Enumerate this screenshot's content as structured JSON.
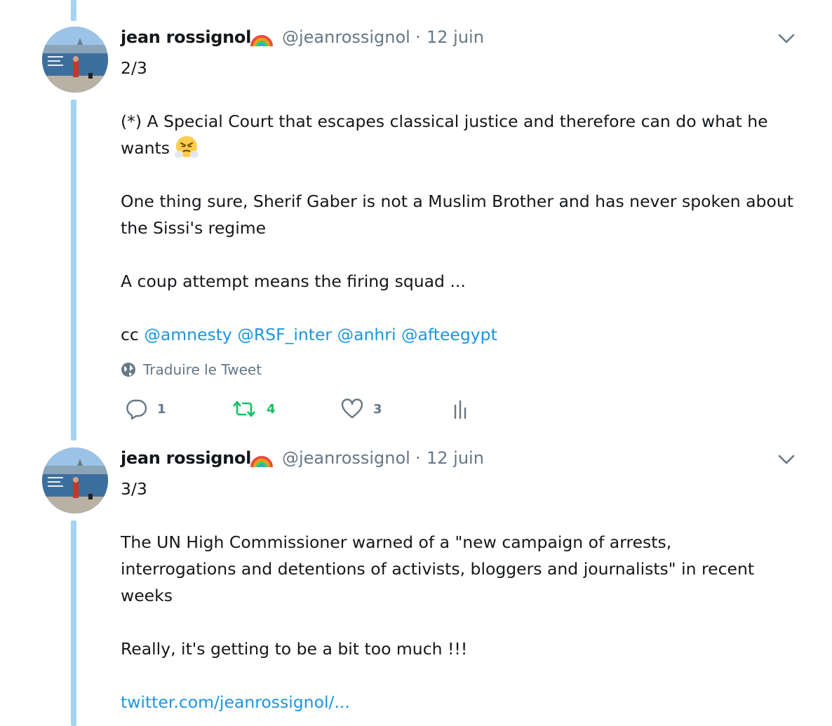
{
  "tweets": [
    {
      "author": "jean rossignol",
      "handle": "@jeanrossignol",
      "separator": "·",
      "date": "12 juin",
      "thread_index": "2/3",
      "line1": "(*) A Special Court that escapes classical justice and therefore can do what he",
      "line2": "wants",
      "emoji": "triumph-face-emoji",
      "line3": "One thing sure, Sherif Gaber is not a Muslim Brother and has never spoken about",
      "line4": "the Sissi's regime",
      "line5": "A coup attempt means the firing squad ...",
      "cc_prefix": "cc",
      "mentions": [
        "@amnesty",
        "@RSF_inter",
        "@anhri",
        "@afteegypt"
      ],
      "translate_label": "Traduire le Tweet",
      "replies": "1",
      "retweets": "4",
      "likes": "3"
    },
    {
      "author": "jean rossignol",
      "handle": "@jeanrossignol",
      "separator": "·",
      "date": "12 juin",
      "thread_index": "3/3",
      "line1": "The UN High Commissioner warned of a \"new campaign of arrests,",
      "line2": "interrogations and detentions of activists, bloggers and journalists\" in recent",
      "line3": "weeks",
      "line4": "Really, it's getting to be a bit too much !!!",
      "link": "twitter.com/jeanrossignol/..."
    }
  ],
  "colors": {
    "thread_line": "#a3d4f7",
    "link": "#1b95e0",
    "retweet": "#17bf63",
    "muted": "#657786"
  }
}
